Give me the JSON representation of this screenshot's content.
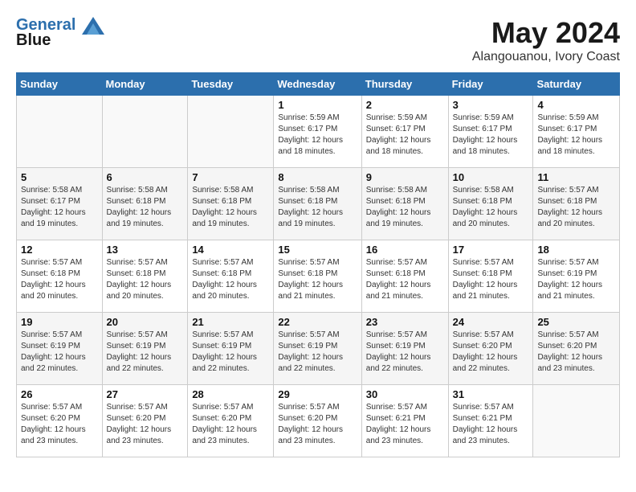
{
  "header": {
    "logo_line1": "General",
    "logo_line2": "Blue",
    "month_year": "May 2024",
    "location": "Alangouanou, Ivory Coast"
  },
  "weekdays": [
    "Sunday",
    "Monday",
    "Tuesday",
    "Wednesday",
    "Thursday",
    "Friday",
    "Saturday"
  ],
  "weeks": [
    [
      {
        "day": "",
        "sunrise": "",
        "sunset": "",
        "daylight": ""
      },
      {
        "day": "",
        "sunrise": "",
        "sunset": "",
        "daylight": ""
      },
      {
        "day": "",
        "sunrise": "",
        "sunset": "",
        "daylight": ""
      },
      {
        "day": "1",
        "sunrise": "Sunrise: 5:59 AM",
        "sunset": "Sunset: 6:17 PM",
        "daylight": "Daylight: 12 hours and 18 minutes."
      },
      {
        "day": "2",
        "sunrise": "Sunrise: 5:59 AM",
        "sunset": "Sunset: 6:17 PM",
        "daylight": "Daylight: 12 hours and 18 minutes."
      },
      {
        "day": "3",
        "sunrise": "Sunrise: 5:59 AM",
        "sunset": "Sunset: 6:17 PM",
        "daylight": "Daylight: 12 hours and 18 minutes."
      },
      {
        "day": "4",
        "sunrise": "Sunrise: 5:59 AM",
        "sunset": "Sunset: 6:17 PM",
        "daylight": "Daylight: 12 hours and 18 minutes."
      }
    ],
    [
      {
        "day": "5",
        "sunrise": "Sunrise: 5:58 AM",
        "sunset": "Sunset: 6:17 PM",
        "daylight": "Daylight: 12 hours and 19 minutes."
      },
      {
        "day": "6",
        "sunrise": "Sunrise: 5:58 AM",
        "sunset": "Sunset: 6:18 PM",
        "daylight": "Daylight: 12 hours and 19 minutes."
      },
      {
        "day": "7",
        "sunrise": "Sunrise: 5:58 AM",
        "sunset": "Sunset: 6:18 PM",
        "daylight": "Daylight: 12 hours and 19 minutes."
      },
      {
        "day": "8",
        "sunrise": "Sunrise: 5:58 AM",
        "sunset": "Sunset: 6:18 PM",
        "daylight": "Daylight: 12 hours and 19 minutes."
      },
      {
        "day": "9",
        "sunrise": "Sunrise: 5:58 AM",
        "sunset": "Sunset: 6:18 PM",
        "daylight": "Daylight: 12 hours and 19 minutes."
      },
      {
        "day": "10",
        "sunrise": "Sunrise: 5:58 AM",
        "sunset": "Sunset: 6:18 PM",
        "daylight": "Daylight: 12 hours and 20 minutes."
      },
      {
        "day": "11",
        "sunrise": "Sunrise: 5:57 AM",
        "sunset": "Sunset: 6:18 PM",
        "daylight": "Daylight: 12 hours and 20 minutes."
      }
    ],
    [
      {
        "day": "12",
        "sunrise": "Sunrise: 5:57 AM",
        "sunset": "Sunset: 6:18 PM",
        "daylight": "Daylight: 12 hours and 20 minutes."
      },
      {
        "day": "13",
        "sunrise": "Sunrise: 5:57 AM",
        "sunset": "Sunset: 6:18 PM",
        "daylight": "Daylight: 12 hours and 20 minutes."
      },
      {
        "day": "14",
        "sunrise": "Sunrise: 5:57 AM",
        "sunset": "Sunset: 6:18 PM",
        "daylight": "Daylight: 12 hours and 20 minutes."
      },
      {
        "day": "15",
        "sunrise": "Sunrise: 5:57 AM",
        "sunset": "Sunset: 6:18 PM",
        "daylight": "Daylight: 12 hours and 21 minutes."
      },
      {
        "day": "16",
        "sunrise": "Sunrise: 5:57 AM",
        "sunset": "Sunset: 6:18 PM",
        "daylight": "Daylight: 12 hours and 21 minutes."
      },
      {
        "day": "17",
        "sunrise": "Sunrise: 5:57 AM",
        "sunset": "Sunset: 6:18 PM",
        "daylight": "Daylight: 12 hours and 21 minutes."
      },
      {
        "day": "18",
        "sunrise": "Sunrise: 5:57 AM",
        "sunset": "Sunset: 6:19 PM",
        "daylight": "Daylight: 12 hours and 21 minutes."
      }
    ],
    [
      {
        "day": "19",
        "sunrise": "Sunrise: 5:57 AM",
        "sunset": "Sunset: 6:19 PM",
        "daylight": "Daylight: 12 hours and 22 minutes."
      },
      {
        "day": "20",
        "sunrise": "Sunrise: 5:57 AM",
        "sunset": "Sunset: 6:19 PM",
        "daylight": "Daylight: 12 hours and 22 minutes."
      },
      {
        "day": "21",
        "sunrise": "Sunrise: 5:57 AM",
        "sunset": "Sunset: 6:19 PM",
        "daylight": "Daylight: 12 hours and 22 minutes."
      },
      {
        "day": "22",
        "sunrise": "Sunrise: 5:57 AM",
        "sunset": "Sunset: 6:19 PM",
        "daylight": "Daylight: 12 hours and 22 minutes."
      },
      {
        "day": "23",
        "sunrise": "Sunrise: 5:57 AM",
        "sunset": "Sunset: 6:19 PM",
        "daylight": "Daylight: 12 hours and 22 minutes."
      },
      {
        "day": "24",
        "sunrise": "Sunrise: 5:57 AM",
        "sunset": "Sunset: 6:20 PM",
        "daylight": "Daylight: 12 hours and 22 minutes."
      },
      {
        "day": "25",
        "sunrise": "Sunrise: 5:57 AM",
        "sunset": "Sunset: 6:20 PM",
        "daylight": "Daylight: 12 hours and 23 minutes."
      }
    ],
    [
      {
        "day": "26",
        "sunrise": "Sunrise: 5:57 AM",
        "sunset": "Sunset: 6:20 PM",
        "daylight": "Daylight: 12 hours and 23 minutes."
      },
      {
        "day": "27",
        "sunrise": "Sunrise: 5:57 AM",
        "sunset": "Sunset: 6:20 PM",
        "daylight": "Daylight: 12 hours and 23 minutes."
      },
      {
        "day": "28",
        "sunrise": "Sunrise: 5:57 AM",
        "sunset": "Sunset: 6:20 PM",
        "daylight": "Daylight: 12 hours and 23 minutes."
      },
      {
        "day": "29",
        "sunrise": "Sunrise: 5:57 AM",
        "sunset": "Sunset: 6:20 PM",
        "daylight": "Daylight: 12 hours and 23 minutes."
      },
      {
        "day": "30",
        "sunrise": "Sunrise: 5:57 AM",
        "sunset": "Sunset: 6:21 PM",
        "daylight": "Daylight: 12 hours and 23 minutes."
      },
      {
        "day": "31",
        "sunrise": "Sunrise: 5:57 AM",
        "sunset": "Sunset: 6:21 PM",
        "daylight": "Daylight: 12 hours and 23 minutes."
      },
      {
        "day": "",
        "sunrise": "",
        "sunset": "",
        "daylight": ""
      }
    ]
  ]
}
